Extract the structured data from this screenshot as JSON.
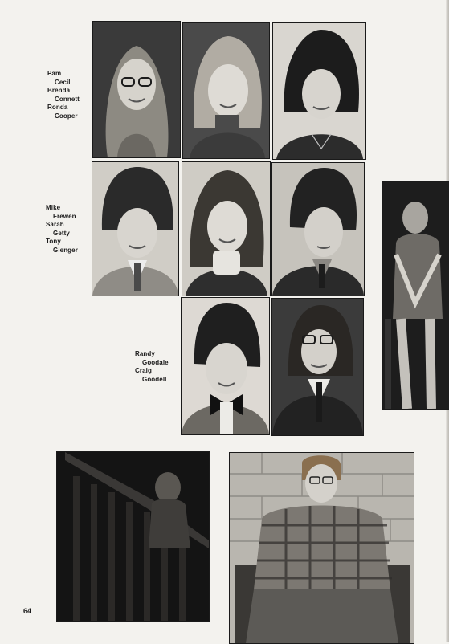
{
  "page": {
    "number": "64"
  },
  "name_groups": [
    {
      "people": [
        {
          "first": "Pam",
          "last": "Cecil"
        },
        {
          "first": "Brenda",
          "last": "Connett"
        },
        {
          "first": "Ronda",
          "last": "Cooper"
        }
      ]
    },
    {
      "people": [
        {
          "first": "Mike",
          "last": "Frewen"
        },
        {
          "first": "Sarah",
          "last": "Getty"
        },
        {
          "first": "Tony",
          "last": "Gienger"
        }
      ]
    },
    {
      "people": [
        {
          "first": "Randy",
          "last": "Goodale"
        },
        {
          "first": "Craig",
          "last": "Goodell"
        }
      ]
    }
  ],
  "portraits": [
    {
      "id": "pam-cecil",
      "subject": "girl with long hair and glasses"
    },
    {
      "id": "brenda-connett",
      "subject": "girl with feathered hair, turtleneck"
    },
    {
      "id": "ronda-cooper",
      "subject": "girl with dark short hair, necklace"
    },
    {
      "id": "mike-frewen",
      "subject": "boy with bowl haircut, plaid jacket, tie"
    },
    {
      "id": "sarah-getty",
      "subject": "girl with shoulder-length hair, turtleneck"
    },
    {
      "id": "tony-gienger",
      "subject": "boy with dark hair, suit and tie"
    },
    {
      "id": "randy-goodale",
      "subject": "boy with bow tie and vest"
    },
    {
      "id": "craig-goodell",
      "subject": "boy with glasses, suit and tie"
    }
  ],
  "candids": [
    {
      "id": "side-candid",
      "subject": "student in patterned sweater"
    },
    {
      "id": "stairway-candid",
      "subject": "person on dark stairway"
    },
    {
      "id": "chair-candid",
      "subject": "young man in plaid shirt seated in chair"
    }
  ]
}
